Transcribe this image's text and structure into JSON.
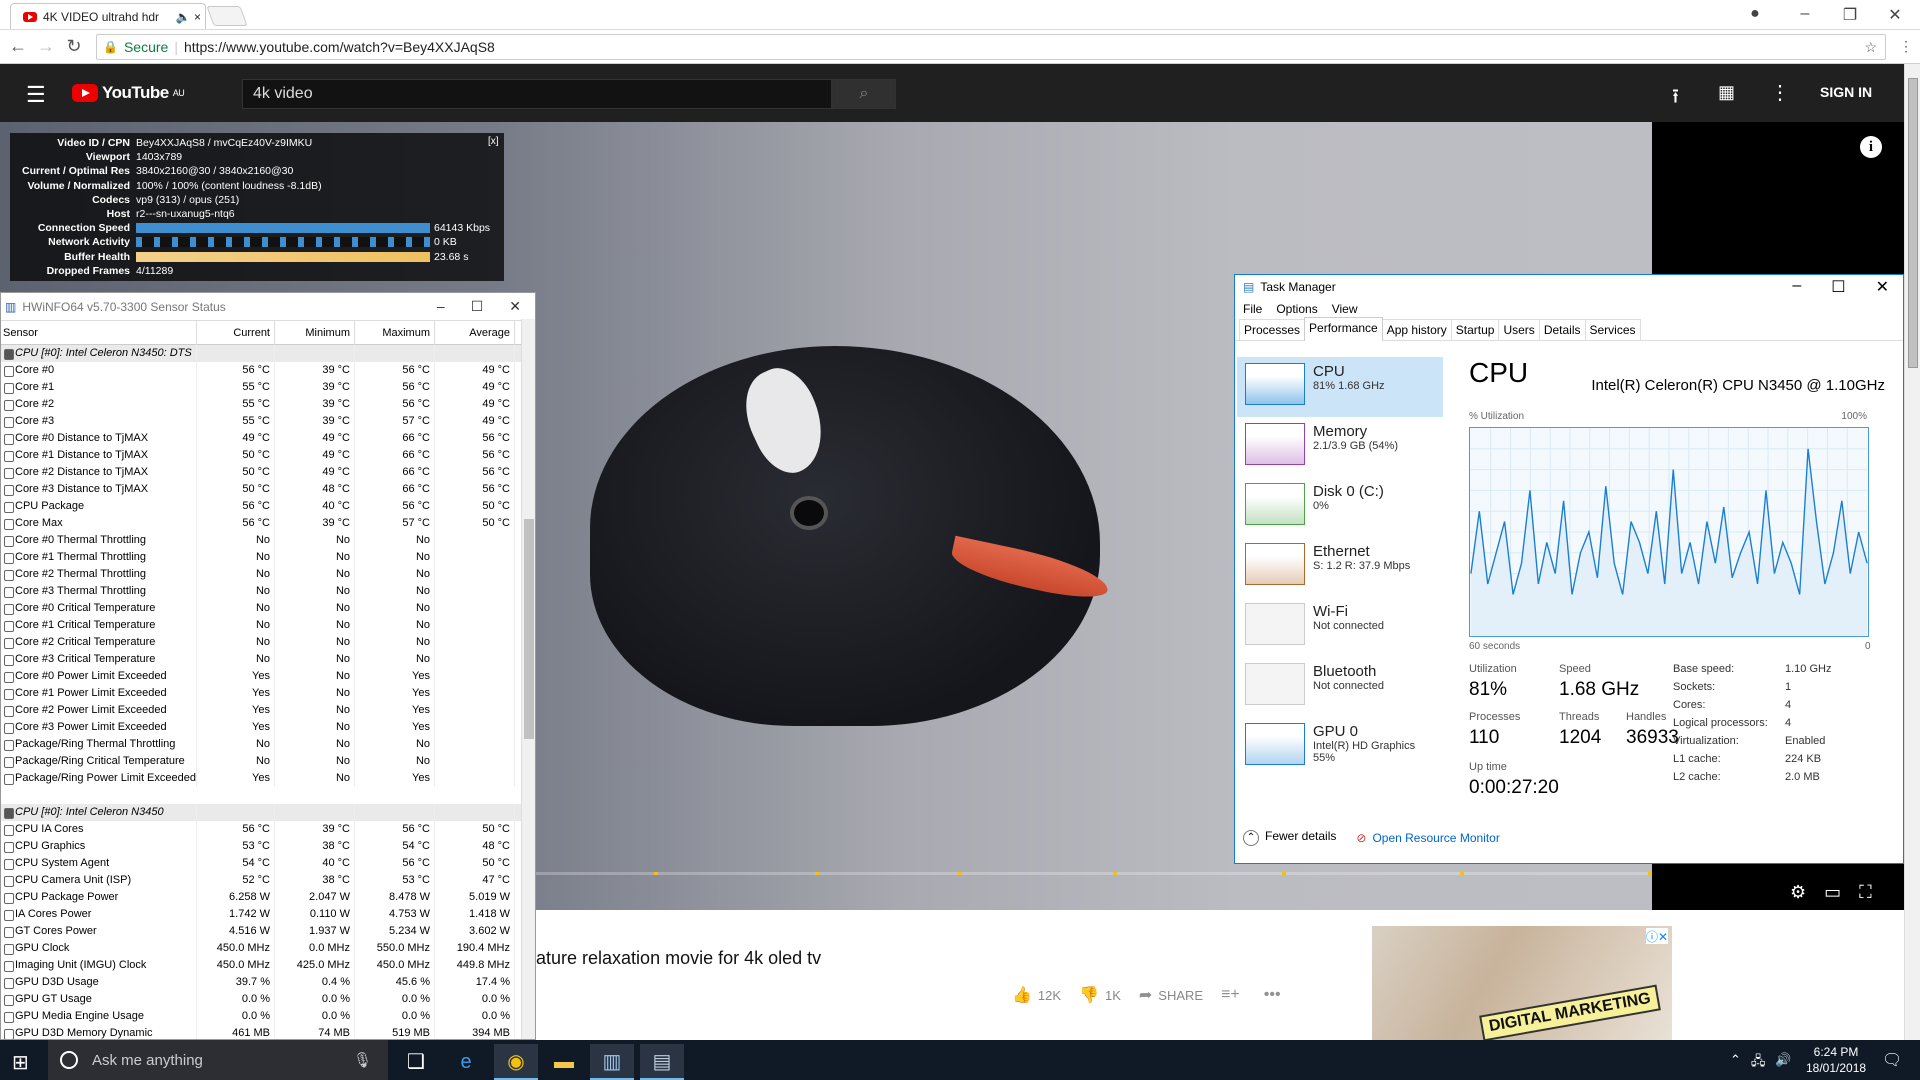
{
  "browser": {
    "tab_title": "4K VIDEO ultrahd hdr",
    "address_secure": "Secure",
    "url": "https://www.youtube.com/watch?v=Bey4XXJAqS8"
  },
  "youtube": {
    "logo": "YouTube",
    "region": "AU",
    "search_value": "4k video",
    "signin": "SIGN IN",
    "video_title_partial": "ature relaxation movie for 4k oled tv",
    "likes": "12K",
    "dislikes": "1K",
    "share": "SHARE",
    "ad_text": "DIGITAL MARKETING"
  },
  "stats": {
    "close": "[x]",
    "rows": [
      {
        "k": "Video ID / CPN",
        "v": "Bey4XXJAqS8 / mvCqEz40V-z9IMKU"
      },
      {
        "k": "Viewport",
        "v": "1403x789"
      },
      {
        "k": "Current / Optimal Res",
        "v": "3840x2160@30 / 3840x2160@30"
      },
      {
        "k": "Volume / Normalized",
        "v": "100% / 100% (content loudness -8.1dB)"
      },
      {
        "k": "Codecs",
        "v": "vp9 (313) / opus (251)"
      },
      {
        "k": "Host",
        "v": "r2---sn-uxanug5-ntq6"
      },
      {
        "k": "Connection Speed",
        "v": "64143 Kbps"
      },
      {
        "k": "Network Activity",
        "v": "0 KB"
      },
      {
        "k": "Buffer Health",
        "v": "23.68 s"
      },
      {
        "k": "Dropped Frames",
        "v": "4/11289"
      }
    ]
  },
  "hwinfo": {
    "title": "HWiNFO64 v5.70-3300 Sensor Status",
    "headers": [
      "Sensor",
      "Current",
      "Minimum",
      "Maximum",
      "Average"
    ],
    "rows": [
      [
        "CPU [#0]: Intel Celeron N3450: DTS",
        "",
        "",
        "",
        ""
      ],
      [
        "Core #0",
        "56 °C",
        "39 °C",
        "56 °C",
        "49 °C"
      ],
      [
        "Core #1",
        "55 °C",
        "39 °C",
        "56 °C",
        "49 °C"
      ],
      [
        "Core #2",
        "55 °C",
        "39 °C",
        "56 °C",
        "49 °C"
      ],
      [
        "Core #3",
        "55 °C",
        "39 °C",
        "57 °C",
        "49 °C"
      ],
      [
        "Core #0 Distance to TjMAX",
        "49 °C",
        "49 °C",
        "66 °C",
        "56 °C"
      ],
      [
        "Core #1 Distance to TjMAX",
        "50 °C",
        "49 °C",
        "66 °C",
        "56 °C"
      ],
      [
        "Core #2 Distance to TjMAX",
        "50 °C",
        "49 °C",
        "66 °C",
        "56 °C"
      ],
      [
        "Core #3 Distance to TjMAX",
        "50 °C",
        "48 °C",
        "66 °C",
        "56 °C"
      ],
      [
        "CPU Package",
        "56 °C",
        "40 °C",
        "56 °C",
        "50 °C"
      ],
      [
        "Core Max",
        "56 °C",
        "39 °C",
        "57 °C",
        "50 °C"
      ],
      [
        "Core #0 Thermal Throttling",
        "No",
        "No",
        "No",
        ""
      ],
      [
        "Core #1 Thermal Throttling",
        "No",
        "No",
        "No",
        ""
      ],
      [
        "Core #2 Thermal Throttling",
        "No",
        "No",
        "No",
        ""
      ],
      [
        "Core #3 Thermal Throttling",
        "No",
        "No",
        "No",
        ""
      ],
      [
        "Core #0 Critical Temperature",
        "No",
        "No",
        "No",
        ""
      ],
      [
        "Core #1 Critical Temperature",
        "No",
        "No",
        "No",
        ""
      ],
      [
        "Core #2 Critical Temperature",
        "No",
        "No",
        "No",
        ""
      ],
      [
        "Core #3 Critical Temperature",
        "No",
        "No",
        "No",
        ""
      ],
      [
        "Core #0 Power Limit Exceeded",
        "Yes",
        "No",
        "Yes",
        ""
      ],
      [
        "Core #1 Power Limit Exceeded",
        "Yes",
        "No",
        "Yes",
        ""
      ],
      [
        "Core #2 Power Limit Exceeded",
        "Yes",
        "No",
        "Yes",
        ""
      ],
      [
        "Core #3 Power Limit Exceeded",
        "Yes",
        "No",
        "Yes",
        ""
      ],
      [
        "Package/Ring Thermal Throttling",
        "No",
        "No",
        "No",
        ""
      ],
      [
        "Package/Ring Critical Temperature",
        "No",
        "No",
        "No",
        ""
      ],
      [
        "Package/Ring Power Limit Exceeded",
        "Yes",
        "No",
        "Yes",
        ""
      ],
      [
        "",
        "",
        "",
        "",
        ""
      ],
      [
        "CPU [#0]: Intel Celeron N3450",
        "",
        "",
        "",
        ""
      ],
      [
        "CPU IA Cores",
        "56 °C",
        "39 °C",
        "56 °C",
        "50 °C"
      ],
      [
        "CPU Graphics",
        "53 °C",
        "38 °C",
        "54 °C",
        "48 °C"
      ],
      [
        "CPU System Agent",
        "54 °C",
        "40 °C",
        "56 °C",
        "50 °C"
      ],
      [
        "CPU Camera Unit (ISP)",
        "52 °C",
        "38 °C",
        "53 °C",
        "47 °C"
      ],
      [
        "CPU Package Power",
        "6.258 W",
        "2.047 W",
        "8.478 W",
        "5.019 W"
      ],
      [
        "IA Cores Power",
        "1.742 W",
        "0.110 W",
        "4.753 W",
        "1.418 W"
      ],
      [
        "GT Cores Power",
        "4.516 W",
        "1.937 W",
        "5.234 W",
        "3.602 W"
      ],
      [
        "GPU Clock",
        "450.0 MHz",
        "0.0 MHz",
        "550.0 MHz",
        "190.4 MHz"
      ],
      [
        "Imaging Unit (IMGU) Clock",
        "450.0 MHz",
        "425.0 MHz",
        "450.0 MHz",
        "449.8 MHz"
      ],
      [
        "GPU D3D Usage",
        "39.7 %",
        "0.4 %",
        "45.6 %",
        "17.4 %"
      ],
      [
        "GPU GT Usage",
        "0.0 %",
        "0.0 %",
        "0.0 %",
        "0.0 %"
      ],
      [
        "GPU Media Engine Usage",
        "0.0 %",
        "0.0 %",
        "0.0 %",
        "0.0 %"
      ],
      [
        "GPU D3D Memory Dynamic",
        "461 MB",
        "74 MB",
        "519 MB",
        "394 MB"
      ]
    ]
  },
  "taskmgr": {
    "title": "Task Manager",
    "menu": [
      "File",
      "Options",
      "View"
    ],
    "tabs": [
      "Processes",
      "Performance",
      "App history",
      "Startup",
      "Users",
      "Details",
      "Services"
    ],
    "side": [
      {
        "name": "CPU",
        "sub": "81%  1.68 GHz"
      },
      {
        "name": "Memory",
        "sub": "2.1/3.9 GB (54%)"
      },
      {
        "name": "Disk 0 (C:)",
        "sub": "0%"
      },
      {
        "name": "Ethernet",
        "sub": "S: 1.2  R: 37.9 Mbps"
      },
      {
        "name": "Wi-Fi",
        "sub": "Not connected"
      },
      {
        "name": "Bluetooth",
        "sub": "Not connected"
      },
      {
        "name": "GPU 0",
        "sub": "Intel(R) HD Graphics",
        "sub2": "55%"
      }
    ],
    "cpu_header": "CPU",
    "cpu_name": "Intel(R) Celeron(R) CPU N3450 @ 1.10GHz",
    "util_label": "% Utilization",
    "util_max": "100%",
    "time_label": "60 seconds",
    "zero": "0",
    "stats": {
      "utilization_l": "Utilization",
      "utilization": "81%",
      "speed_l": "Speed",
      "speed": "1.68 GHz",
      "processes_l": "Processes",
      "processes": "110",
      "threads_l": "Threads",
      "threads": "1204",
      "handles_l": "Handles",
      "handles": "36933",
      "uptime_l": "Up time",
      "uptime": "0:00:27:20"
    },
    "details": [
      [
        "Base speed:",
        "1.10 GHz"
      ],
      [
        "Sockets:",
        "1"
      ],
      [
        "Cores:",
        "4"
      ],
      [
        "Logical processors:",
        "4"
      ],
      [
        "Virtualization:",
        "Enabled"
      ],
      [
        "L1 cache:",
        "224 KB"
      ],
      [
        "L2 cache:",
        "2.0 MB"
      ]
    ],
    "fewer": "Fewer details",
    "resmon": "Open Resource Monitor",
    "cpu_history": [
      30,
      60,
      25,
      40,
      55,
      20,
      35,
      70,
      25,
      45,
      30,
      65,
      20,
      40,
      50,
      28,
      72,
      35,
      20,
      55,
      45,
      30,
      60,
      25,
      80,
      30,
      45,
      25,
      55,
      35,
      62,
      28,
      40,
      50,
      25,
      70,
      30,
      45,
      35,
      20,
      90,
      55,
      25,
      40,
      65,
      30,
      50,
      35
    ]
  },
  "taskbar": {
    "search": "Ask me anything",
    "time": "6:24 PM",
    "date": "18/01/2018"
  }
}
